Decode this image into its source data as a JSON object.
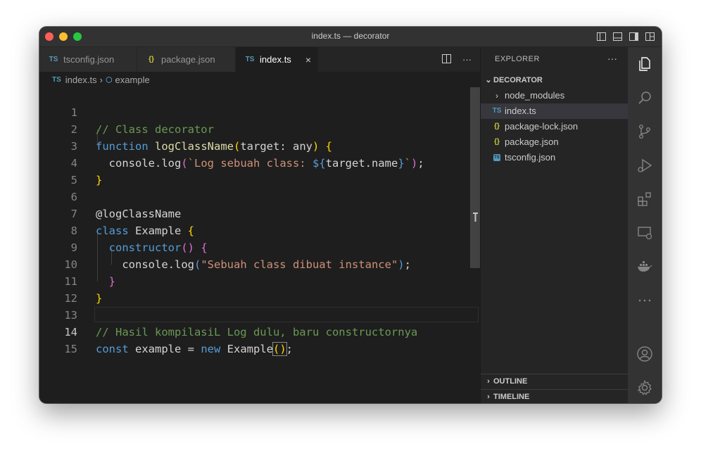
{
  "window": {
    "title": "index.ts — decorator"
  },
  "tabs": [
    {
      "label": "tsconfig.json",
      "icon": "TS"
    },
    {
      "label": "package.json",
      "icon": "{}"
    },
    {
      "label": "index.ts",
      "icon": "TS",
      "close": "×"
    }
  ],
  "editor_actions": {
    "more": "···"
  },
  "breadcrumb": {
    "file": "index.ts",
    "file_icon": "TS",
    "symbol": "example"
  },
  "code": {
    "line_numbers": [
      "1",
      "2",
      "3",
      "4",
      "5",
      "6",
      "7",
      "8",
      "9",
      "10",
      "11",
      "12",
      "13",
      "14",
      "15"
    ],
    "current_line": "14"
  },
  "explorer": {
    "title": "EXPLORER",
    "more": "···",
    "folder": "DECORATOR",
    "items": [
      {
        "label": "node_modules",
        "icon": "›"
      },
      {
        "label": "index.ts",
        "icon": "TS"
      },
      {
        "label": "package-lock.json",
        "icon": "{}"
      },
      {
        "label": "package.json",
        "icon": "{}"
      },
      {
        "label": "tsconfig.json",
        "icon": "TS"
      }
    ],
    "outline": "OUTLINE",
    "timeline": "TIMELINE"
  },
  "activity_bar": {
    "icons": [
      "explorer-icon",
      "search-icon",
      "source-control-icon",
      "run-debug-icon",
      "extensions-icon",
      "remote-explorer-icon",
      "docker-icon",
      "more-icon",
      "account-icon",
      "settings-gear-icon"
    ]
  },
  "colors": {
    "comment": "#6a9955",
    "keyword": "#569cd6",
    "function": "#dcdcaa",
    "string": "#ce9178",
    "class": "#4ec9b0",
    "bracket1": "#ffd700",
    "bracket2": "#da70d6"
  }
}
